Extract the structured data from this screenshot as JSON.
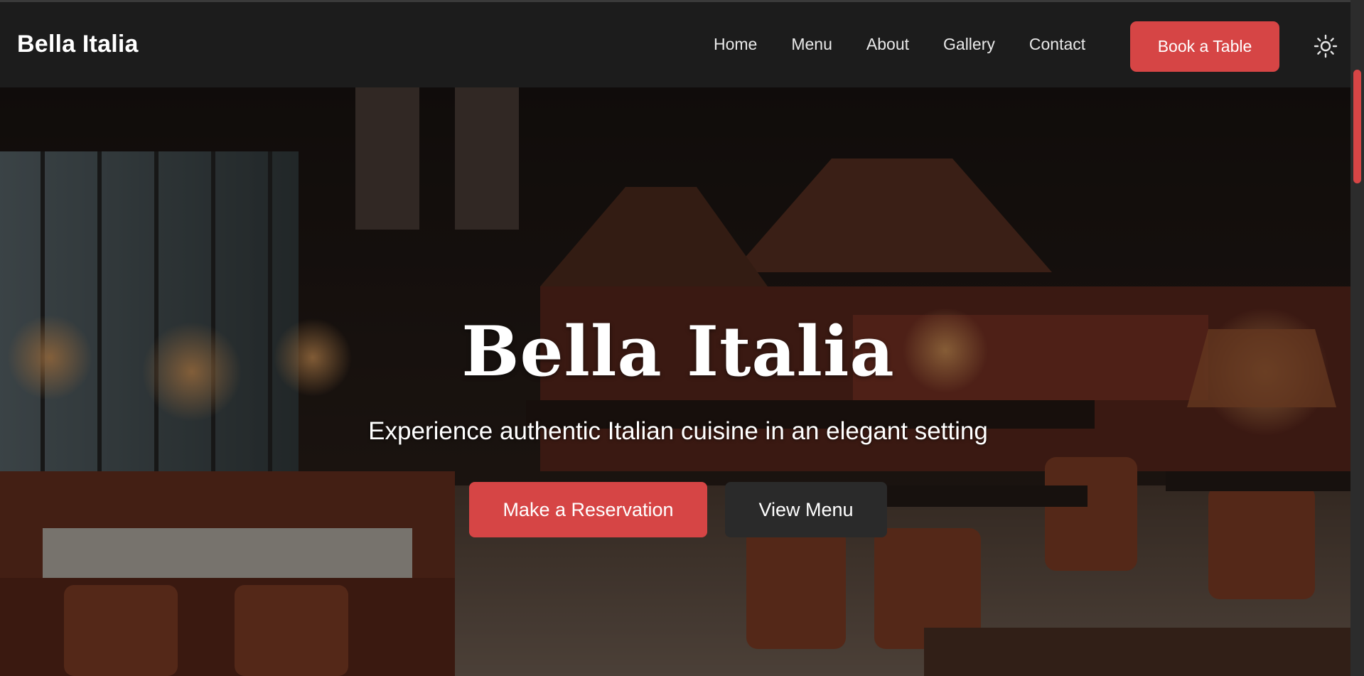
{
  "brand": "Bella Italia",
  "nav": {
    "links": [
      "Home",
      "Menu",
      "About",
      "Gallery",
      "Contact"
    ],
    "cta_label": "Book a Table",
    "theme_icon": "sun-icon"
  },
  "hero": {
    "title": "Bella Italia",
    "subtitle": "Experience authentic Italian cuisine in an elegant setting",
    "primary_button": "Make a Reservation",
    "secondary_button": "View Menu",
    "background": "restaurant-interior-photo"
  },
  "colors": {
    "accent": "#d64545",
    "nav_bg": "#1c1c1c",
    "secondary_button_bg": "#2a2a2a",
    "text": "#ffffff"
  }
}
